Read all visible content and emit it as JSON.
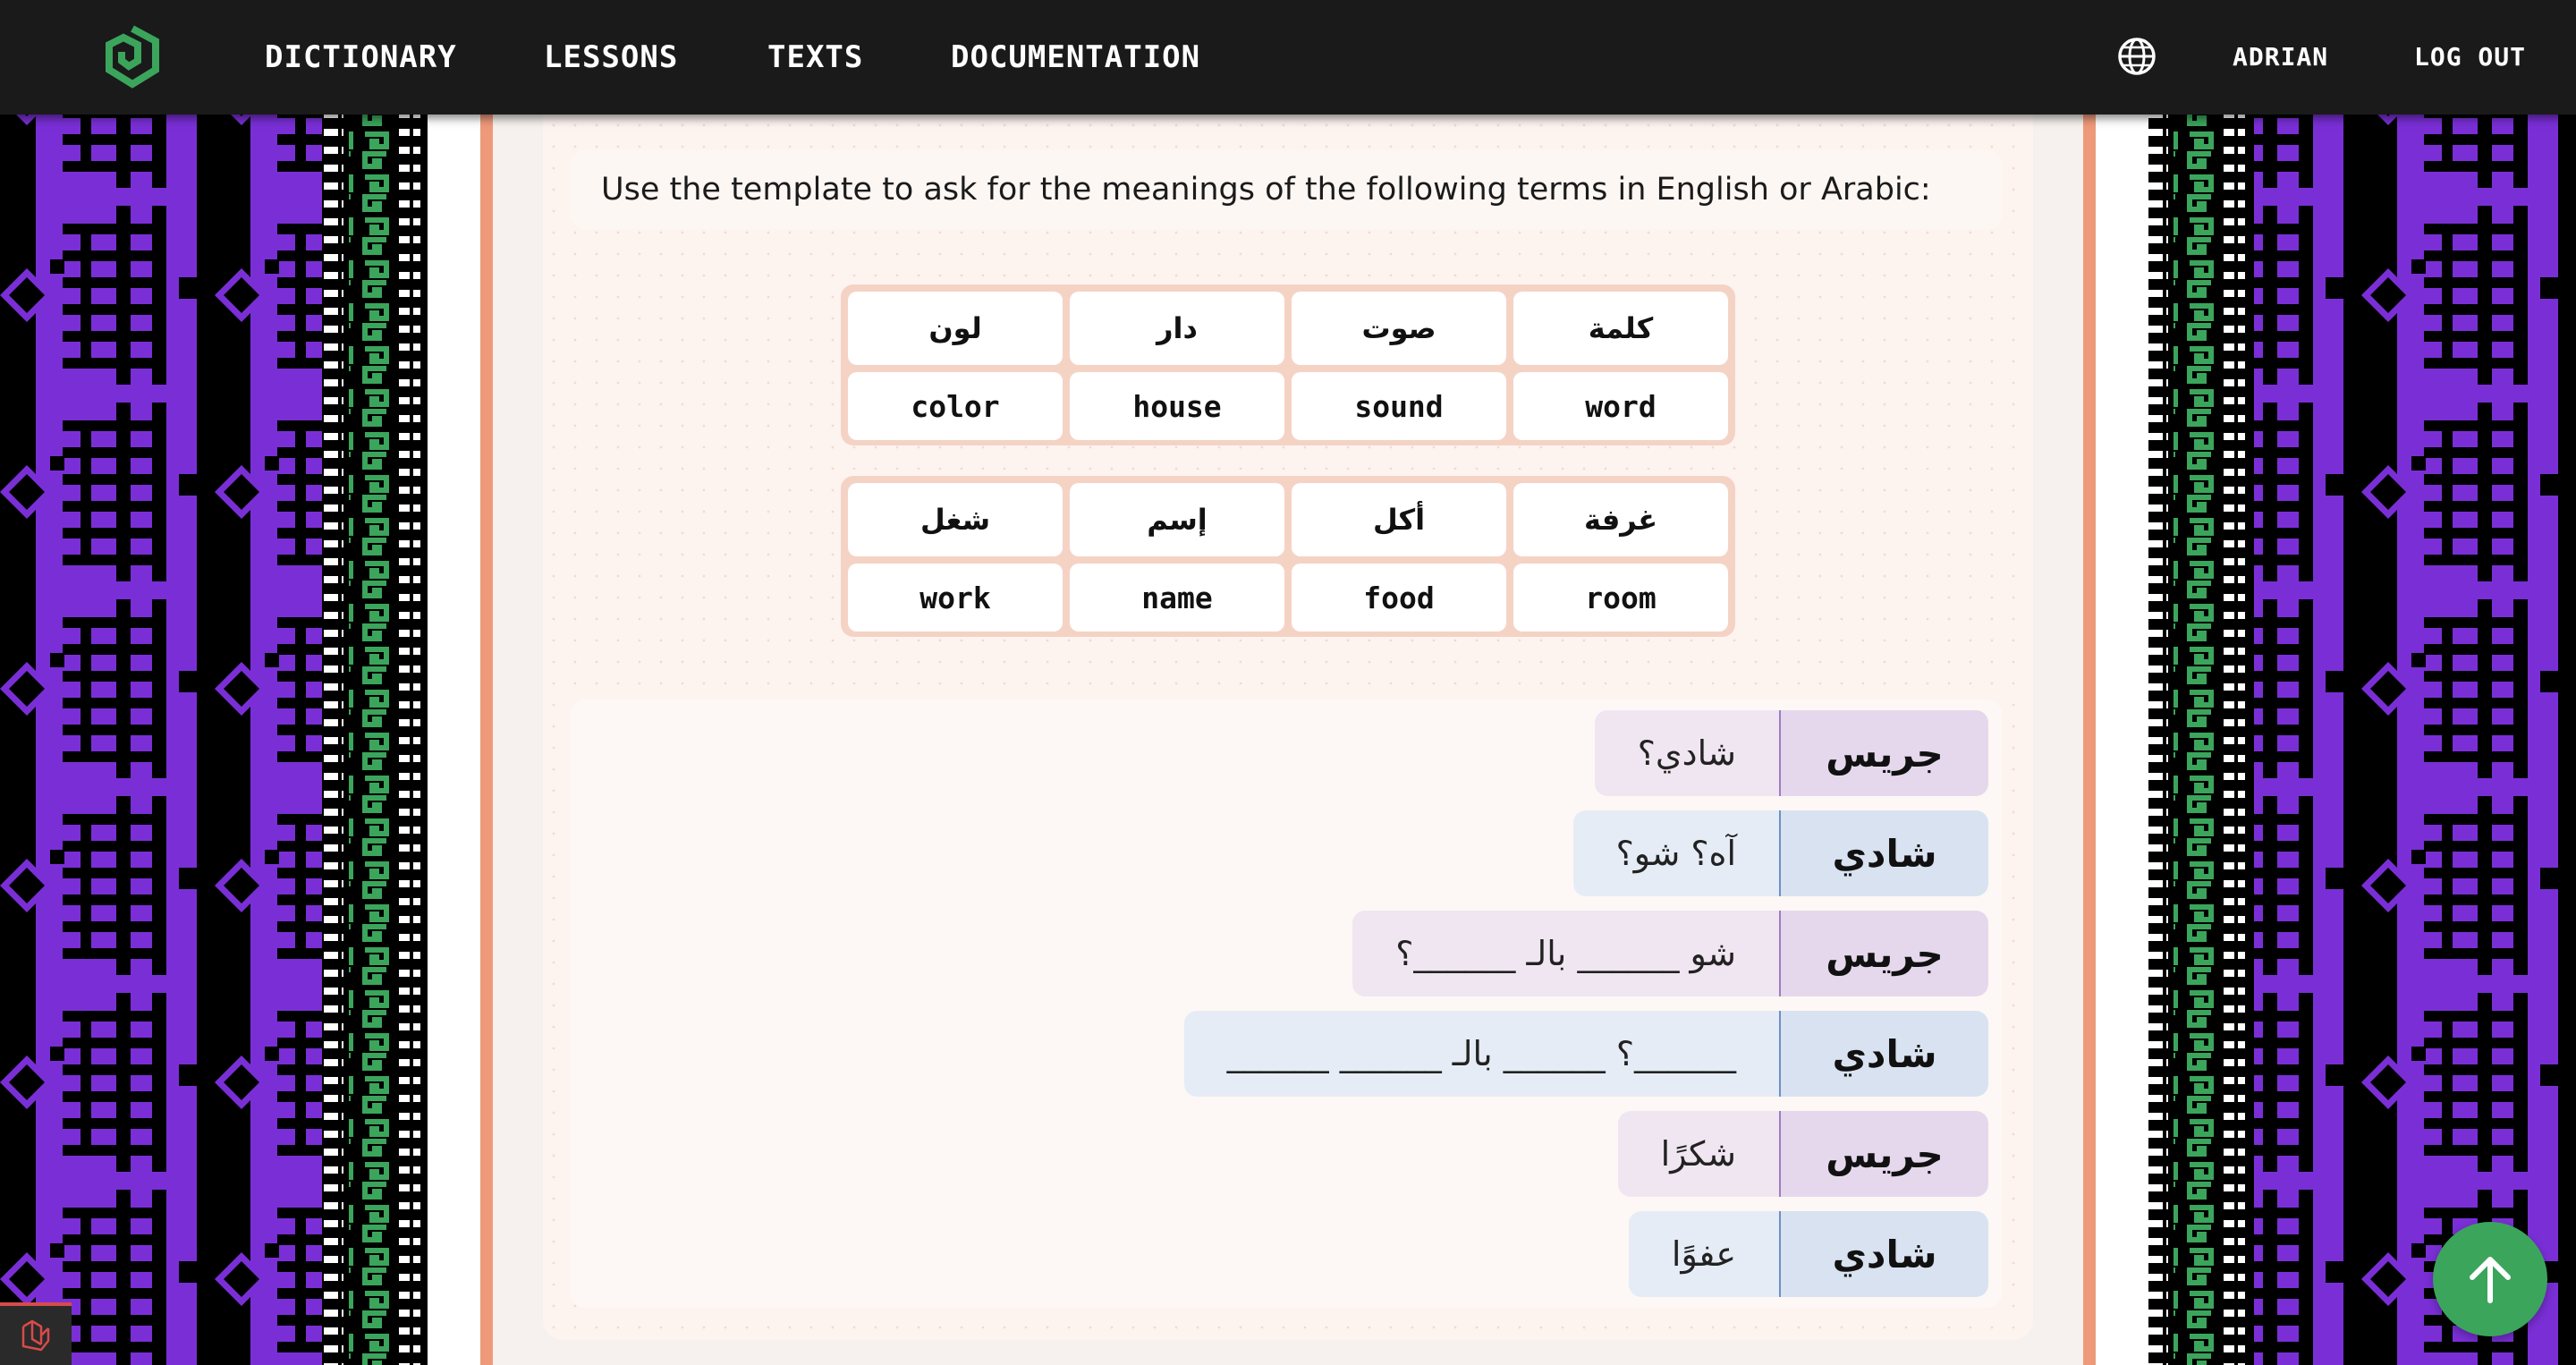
{
  "nav": {
    "links": [
      "DICTIONARY",
      "LESSONS",
      "TEXTS",
      "DOCUMENTATION"
    ],
    "user": "ADRIAN",
    "logout": "LOG OUT",
    "icons": {
      "logo": "site-logo-icon",
      "language": "globe-icon"
    }
  },
  "exercise": {
    "instruction": "Use the template to ask for the meanings of the following terms in English or Arabic:",
    "vocab_sets": [
      {
        "arabic": [
          "كلمة",
          "صوت",
          "دار",
          "لون"
        ],
        "english": [
          "word",
          "sound",
          "house",
          "color"
        ]
      },
      {
        "arabic": [
          "غرفة",
          "أكل",
          "إسم",
          "شغل"
        ],
        "english": [
          "room",
          "food",
          "name",
          "work"
        ]
      }
    ],
    "dialogue": [
      {
        "speaker": "جريس",
        "text": "شادي؟"
      },
      {
        "speaker": "شادي",
        "text": "آه؟ شو؟"
      },
      {
        "speaker": "جريس",
        "text": "شو ______ بالـ ______؟"
      },
      {
        "speaker": "شادي",
        "text": "______؟ ______ بالـ ______ ______"
      },
      {
        "speaker": "جريس",
        "text": "شكرًا"
      },
      {
        "speaker": "شادي",
        "text": "عفوًا"
      }
    ]
  },
  "colors": {
    "navbar": "#1a1a1a",
    "accent_green": "#3ba55c",
    "frame_salmon": "#ee9a7a",
    "tatreez_purple": "#7a2fd6"
  }
}
